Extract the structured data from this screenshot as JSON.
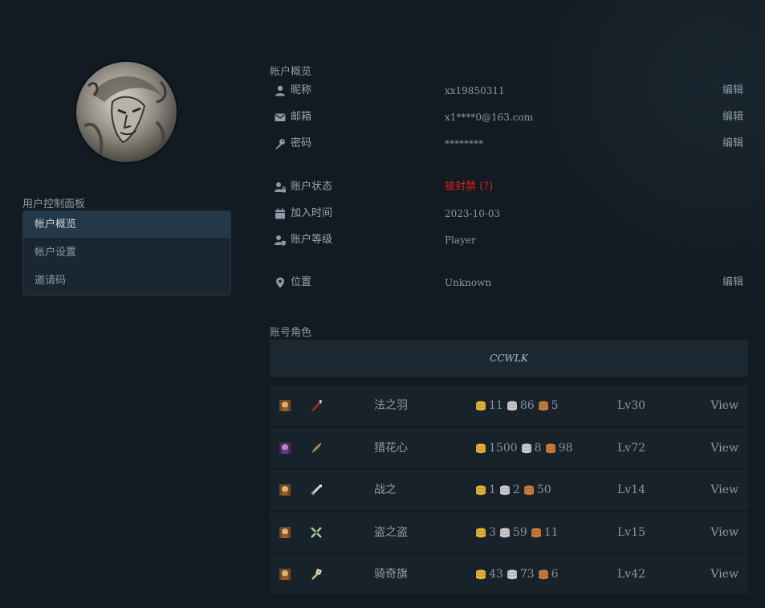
{
  "sidebar": {
    "panel_title": "用户控制面板",
    "items": [
      {
        "label": "帐户概览",
        "active": true
      },
      {
        "label": "帐户设置",
        "active": false
      },
      {
        "label": "邀请码",
        "active": false
      }
    ]
  },
  "overview": {
    "title": "帐户概览",
    "edit_label": "编辑",
    "rows": {
      "nickname": {
        "label": "昵称",
        "value": "xx19850311"
      },
      "email": {
        "label": "邮箱",
        "value": "x1****0@163.com"
      },
      "password": {
        "label": "密码",
        "value": "********"
      },
      "status": {
        "label": "账户状态",
        "value": "被封禁 (?)"
      },
      "joined": {
        "label": "加入时间",
        "value": "2023-10-03"
      },
      "level": {
        "label": "账户等级",
        "value": "Player"
      },
      "location": {
        "label": "位置",
        "value": "Unknown"
      }
    }
  },
  "characters": {
    "title": "账号角色",
    "realm": "CCWLK",
    "view_label": "View",
    "list": [
      {
        "name": "法之羽",
        "gold": "11",
        "silver": "86",
        "copper": "5",
        "level": "Lv30"
      },
      {
        "name": "猎花心",
        "gold": "1500",
        "silver": "8",
        "copper": "98",
        "level": "Lv72"
      },
      {
        "name": "战之",
        "gold": "1",
        "silver": "2",
        "copper": "50",
        "level": "Lv14"
      },
      {
        "name": "盗之盗",
        "gold": "3",
        "silver": "59",
        "copper": "11",
        "level": "Lv15"
      },
      {
        "name": "骑奇旗",
        "gold": "43",
        "silver": "73",
        "copper": "6",
        "level": "Lv42"
      }
    ]
  },
  "colors": {
    "background": "#121a22",
    "banned": "#e31b1b",
    "menu_active": "#23394a",
    "gold": "#e0b13a",
    "silver": "#c9c9c9",
    "copper": "#c87a3c"
  }
}
